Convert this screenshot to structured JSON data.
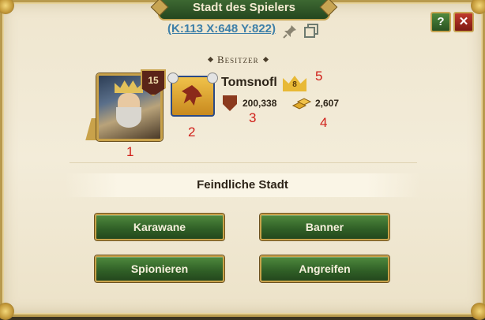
{
  "window": {
    "title": "Stadt des Spielers"
  },
  "header": {
    "coordinates": "(K:113 X:648 Y:822)",
    "help_label": "?",
    "close_label": "✕"
  },
  "owner": {
    "section_label": "Besitzer",
    "portrait_level": "15",
    "name": "Tomsnofl",
    "rank": "8",
    "might": "200,338",
    "gold": "2,607"
  },
  "annotations": [
    "1",
    "2",
    "3",
    "4",
    "5"
  ],
  "city_type": "Feindliche Stadt",
  "buttons": {
    "caravan": "Karawane",
    "banner": "Banner",
    "spy": "Spionieren",
    "attack": "Angreifen"
  },
  "colors": {
    "accent_green": "#2f5e26",
    "gold_border": "#c9a24a",
    "link_blue": "#3d7fa8",
    "annotation_red": "#d0201a"
  }
}
